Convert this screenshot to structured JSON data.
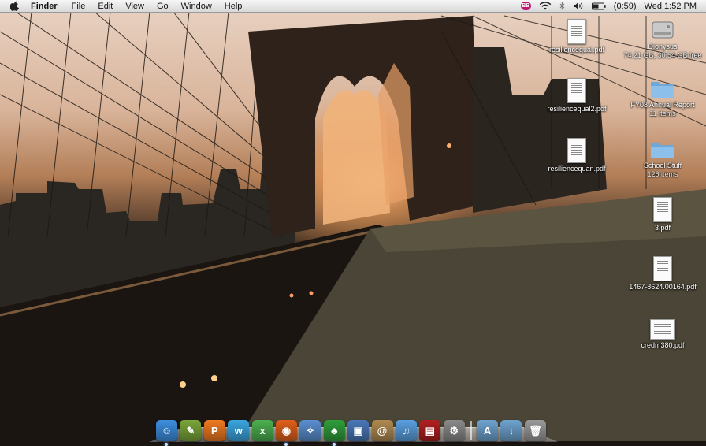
{
  "menubar": {
    "app_menu": "Finder",
    "menus": [
      "File",
      "Edit",
      "View",
      "Go",
      "Window",
      "Help"
    ],
    "status": {
      "bb_badge": "BB",
      "battery": "(0:59)",
      "clock": "Wed 1:52 PM"
    }
  },
  "desktop": {
    "icons": [
      {
        "label": "resiliencequal.pdf",
        "sub": "",
        "kind": "pdf"
      },
      {
        "label": "resiliencequal2.pdf",
        "sub": "",
        "kind": "pdf"
      },
      {
        "label": "resiliencequan.pdf",
        "sub": "",
        "kind": "pdf"
      },
      {
        "label": "Dionysus",
        "sub": "74.21 GB, 30.54 GB free",
        "kind": "drive"
      },
      {
        "label": "FY08 Annual Report",
        "sub": "11 items",
        "kind": "folder"
      },
      {
        "label": "School Stuff",
        "sub": "126 items",
        "kind": "folder"
      },
      {
        "label": "3.pdf",
        "sub": "",
        "kind": "pdf"
      },
      {
        "label": "1467-8624.00164.pdf",
        "sub": "",
        "kind": "pdf"
      },
      {
        "label": "credm380.pdf",
        "sub": "",
        "kind": "pdf"
      }
    ]
  },
  "dock": {
    "apps": [
      {
        "name": "finder-icon",
        "glyph": "☺",
        "color": "#3d8fe0"
      },
      {
        "name": "pencil-app-icon",
        "glyph": "✎",
        "color": "#7aa63a"
      },
      {
        "name": "p-app-icon",
        "glyph": "P",
        "color": "#f07a20"
      },
      {
        "name": "w-app-icon",
        "glyph": "w",
        "color": "#3aa6e0"
      },
      {
        "name": "x-app-icon",
        "glyph": "x",
        "color": "#4cb050"
      },
      {
        "name": "firefox-icon",
        "glyph": "◉",
        "color": "#e0601a"
      },
      {
        "name": "safari-icon",
        "glyph": "✧",
        "color": "#5a8fd0"
      },
      {
        "name": "adium-icon",
        "glyph": "♣",
        "color": "#2f9e3a"
      },
      {
        "name": "preview-icon",
        "glyph": "▣",
        "color": "#4a78b8"
      },
      {
        "name": "address-book-icon",
        "glyph": "@",
        "color": "#b08a50"
      },
      {
        "name": "itunes-icon",
        "glyph": "♫",
        "color": "#5aa0e0"
      },
      {
        "name": "photo-app-icon",
        "glyph": "▤",
        "color": "#b02020"
      },
      {
        "name": "system-preferences-icon",
        "glyph": "⚙",
        "color": "#8a8a8a"
      }
    ],
    "stacks": [
      {
        "name": "applications-stack-icon",
        "glyph": "A",
        "color": "#6fa3cf"
      },
      {
        "name": "downloads-stack-icon",
        "glyph": "↓",
        "color": "#6fa3cf"
      },
      {
        "name": "trash-icon",
        "glyph": "🗑",
        "color": "#9a9a9a"
      }
    ]
  }
}
